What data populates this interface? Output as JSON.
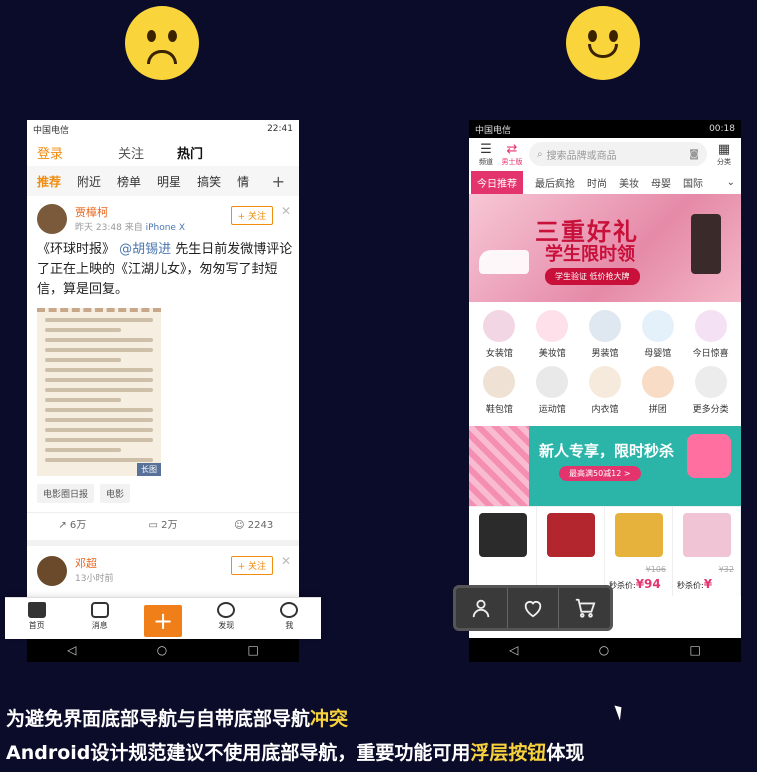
{
  "left_phone": {
    "status_bar": {
      "carrier": "中国电信",
      "time": "22:41"
    },
    "top_tabs": {
      "login": "登录",
      "follow": "关注",
      "hot": "热门"
    },
    "categories": [
      "推荐",
      "附近",
      "榜单",
      "明星",
      "搞笑",
      "情"
    ],
    "category_add": "+",
    "post1": {
      "author": "贾樟柯",
      "time": "昨天 23:48",
      "source_prefix": "来自",
      "device": "iPhone X",
      "follow_label": "+ 关注",
      "text_a": "《环球时报》",
      "mention": "@胡锡进",
      "text_b": " 先生日前发微博评论了正在上映的《江湖儿女》，匆匆写了封短信，算是回复。",
      "image_tag": "长图",
      "chips": [
        "电影圈日报",
        "电影"
      ],
      "reposts": "6万",
      "comments": "2万",
      "likes": "2243"
    },
    "post2": {
      "author": "邓超",
      "time": "13小时前",
      "follow_label": "+ 关注"
    },
    "bottom_nav": {
      "home": "首页",
      "messages": "消息",
      "plus": "+",
      "discover": "发现",
      "me": "我"
    }
  },
  "right_phone": {
    "status_bar": {
      "carrier": "中国电信",
      "time": "00:18"
    },
    "top": {
      "channel_label": "频道",
      "men_label": "男士版",
      "search_placeholder": "搜索品牌或商品",
      "category_label": "分类"
    },
    "tabs": [
      "今日推荐",
      "最后疯抢",
      "时尚",
      "美妆",
      "母婴",
      "国际"
    ],
    "banner": {
      "line1": "三重好礼",
      "line2": "学生限时领",
      "line3": "学生验证  低价抢大牌"
    },
    "grid": [
      {
        "label": "女装馆",
        "color": "#f3d6e4"
      },
      {
        "label": "美妆馆",
        "color": "#fde0ea"
      },
      {
        "label": "男装馆",
        "color": "#dfe7f0"
      },
      {
        "label": "母婴馆",
        "color": "#e4f0fa"
      },
      {
        "label": "今日惊喜",
        "color": "#f5e1f4"
      },
      {
        "label": "鞋包馆",
        "color": "#efe1d3"
      },
      {
        "label": "运动馆",
        "color": "#e9e9e9"
      },
      {
        "label": "内衣馆",
        "color": "#f6eadc"
      },
      {
        "label": "拼团",
        "color": "#f8dcc6"
      },
      {
        "label": "更多分类",
        "color": "#ececec"
      }
    ],
    "promo": {
      "title": "新人专享，限时秒杀",
      "sub": "最高满50减12 >"
    },
    "products": [
      {
        "old": "",
        "sale_label": "",
        "price": "",
        "color": "#2b2b2b"
      },
      {
        "old": "",
        "sale_label": "",
        "price": "",
        "color": "#b3262e"
      },
      {
        "old": "¥106",
        "sale_label": "秒杀价:",
        "price": "¥94",
        "color": "#e7b23c"
      },
      {
        "old": "¥32",
        "sale_label": "秒杀价:",
        "price": "¥",
        "color": "#f0c4d4"
      }
    ]
  },
  "captions": {
    "line1_a": "为避免界面底部导航与自带底部导航",
    "line1_hl": "冲突",
    "line2_a": "Android设计规范建议不使用底部导航，重要功能可用",
    "line2_hl": "浮层按钮",
    "line2_b": "体现"
  }
}
